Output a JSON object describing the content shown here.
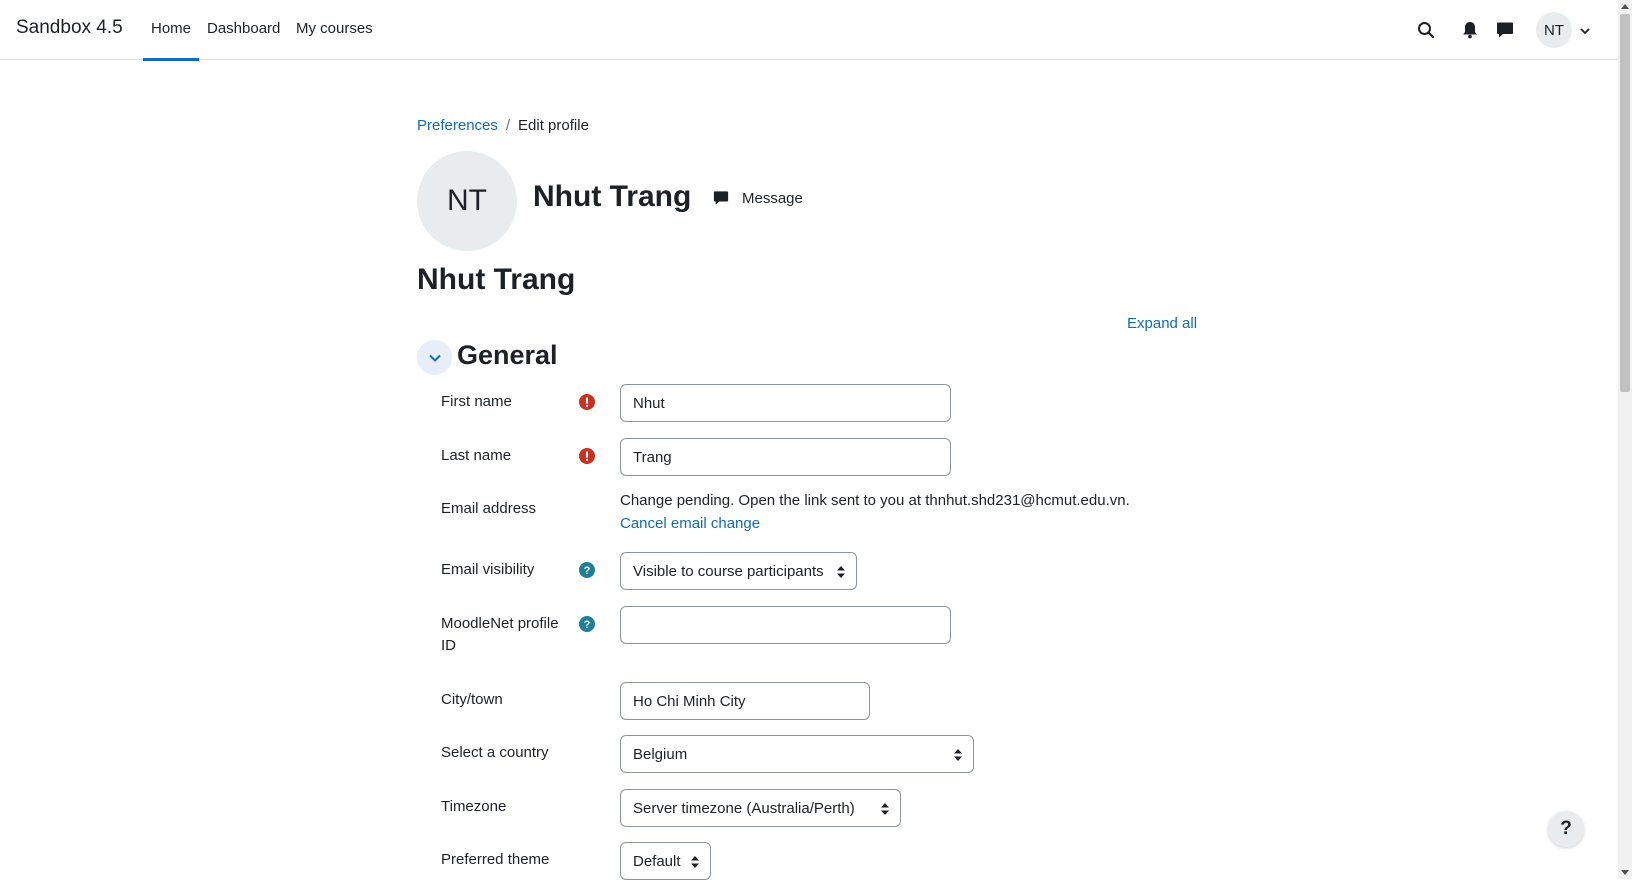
{
  "navbar": {
    "brand": "Sandbox 4.5",
    "links": [
      {
        "label": "Home",
        "active": true
      },
      {
        "label": "Dashboard",
        "active": false
      },
      {
        "label": "My courses",
        "active": false
      }
    ],
    "icons": [
      "search-icon",
      "bell-icon",
      "chat-icon"
    ],
    "user_initials": "NT"
  },
  "breadcrumb": {
    "items": [
      "Preferences",
      "Edit profile"
    ],
    "separator": "/"
  },
  "profile": {
    "initials": "NT",
    "name": "Nhut Trang",
    "message_label": "Message"
  },
  "page_title": "Nhut Trang",
  "expand_all": "Expand all",
  "section": {
    "title": "General"
  },
  "form": {
    "first_name": {
      "label": "First name",
      "value": "Nhut"
    },
    "last_name": {
      "label": "Last name",
      "value": "Trang"
    },
    "email": {
      "label": "Email address",
      "pending_text": "Change pending. Open the link sent to you at thnhut.shd231@hcmut.edu.vn.",
      "cancel_label": "Cancel email change"
    },
    "email_visibility": {
      "label": "Email visibility",
      "selected": "Visible to course participants"
    },
    "moodlenet": {
      "label_line1": "MoodleNet profile",
      "label_line2": "ID",
      "value": ""
    },
    "city": {
      "label": "City/town",
      "value": "Ho Chi Minh City"
    },
    "country": {
      "label": "Select a country",
      "selected": "Belgium"
    },
    "timezone": {
      "label": "Timezone",
      "selected": "Server timezone (Australia/Perth)"
    },
    "theme": {
      "label": "Preferred theme",
      "selected": "Default"
    }
  },
  "help_button": "?",
  "colors": {
    "link": "#0f6cbf",
    "required": "#ca3120",
    "help": "#1f7e9a",
    "text": "#1d2125",
    "border": "#8f959e"
  }
}
